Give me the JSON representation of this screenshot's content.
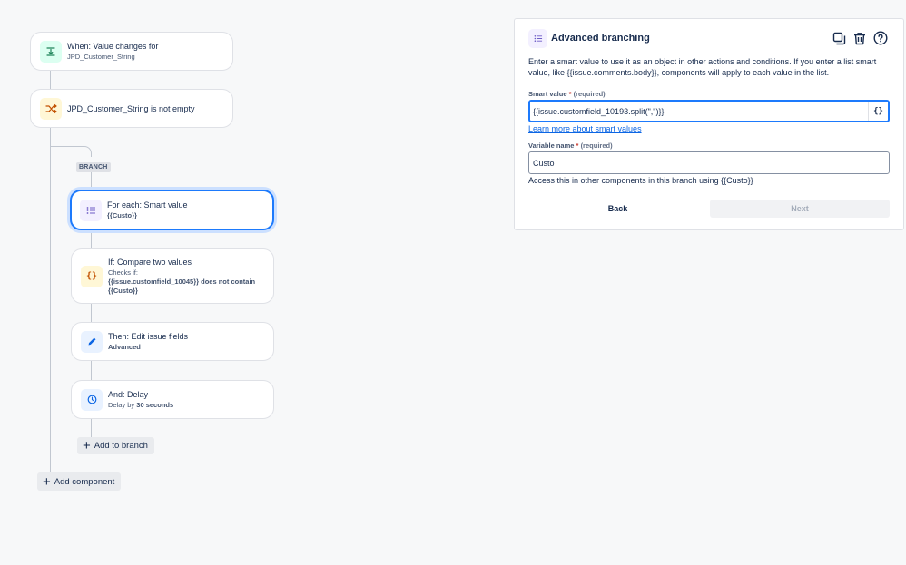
{
  "rule": {
    "trigger": {
      "title": "When: Value changes for",
      "subtitle": "JPD_Customer_String",
      "icon": "field-value-icon"
    },
    "condition": {
      "title": "JPD_Customer_String is not empty",
      "icon": "shuffle-icon"
    },
    "branch_label": "BRANCH",
    "branch_items": [
      {
        "title": "For each: Smart value",
        "subtitle": "{{Custo}}",
        "icon": "list-icon",
        "selected": true
      },
      {
        "title": "If: Compare two values",
        "checks_label": "Checks if:",
        "checks_value": "{{issue.customfield_10045}} does not contain {{Custo}}",
        "icon": "braces-icon"
      },
      {
        "title": "Then: Edit issue fields",
        "subtitle": "Advanced",
        "icon": "pencil-icon"
      },
      {
        "title": "And: Delay",
        "subtitle_prefix": "Delay by",
        "subtitle_value": "30 seconds",
        "icon": "clock-icon"
      }
    ],
    "add_to_branch_label": "Add to branch",
    "add_component_label": "Add component"
  },
  "panel": {
    "title": "Advanced branching",
    "description": "Enter a smart value to use it as an object in other actions and conditions. If you enter a list smart value, like {{issue.comments.body}}, components will apply to each value in the list.",
    "smart_value_label": "Smart value",
    "required_marker": "*",
    "required_text": "(required)",
    "smart_value": "{{issue.customfield_10193.split(\",\")}}",
    "smart_value_suffix": "{}",
    "learn_more": "Learn more about smart values",
    "variable_name_label": "Variable name",
    "variable_name": "Custo",
    "helper_text": "Access this in other components in this branch using {{Custo}}",
    "back_label": "Back",
    "next_label": "Next"
  },
  "colors": {
    "accent": "#1d7afc",
    "trigger_bg": "#dcfff1",
    "condition_bg": "#fff7d6",
    "branch_bg": "#f3f0ff",
    "action_bg": "#e9f2ff"
  }
}
